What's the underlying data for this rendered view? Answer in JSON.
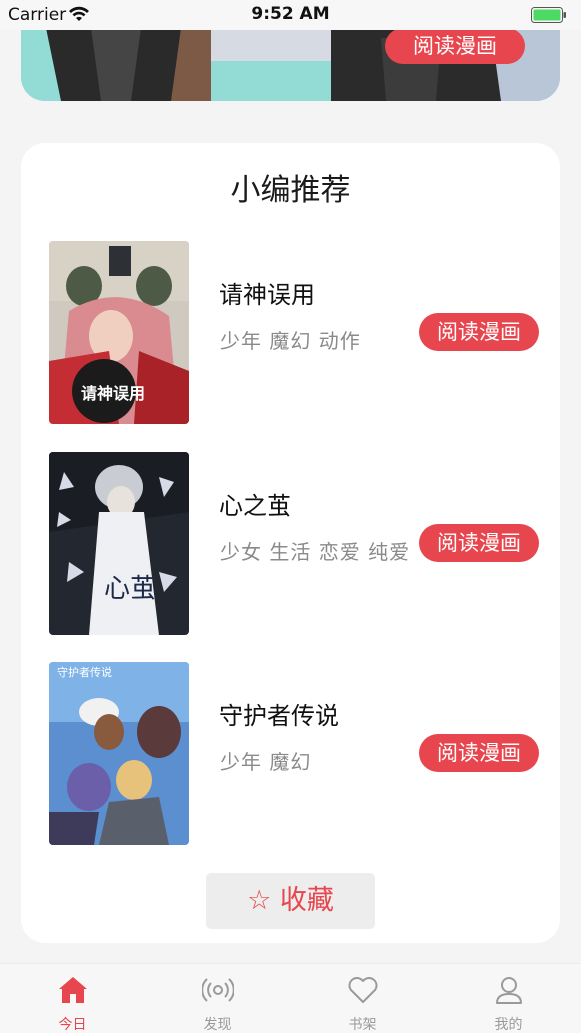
{
  "status_bar": {
    "carrier": "Carrier",
    "time": "9:52 AM"
  },
  "banner": {
    "read_button": "阅读漫画"
  },
  "recommend": {
    "title": "小编推荐",
    "comics": [
      {
        "name": "请神误用",
        "tags": "少年 魔幻 动作",
        "read_button": "阅读漫画",
        "cover_text": "请神误用"
      },
      {
        "name": "心之茧",
        "tags": "少女 生活 恋爱 纯爱",
        "read_button": "阅读漫画",
        "cover_text": "心茧"
      },
      {
        "name": "守护者传说",
        "tags": "少年 魔幻",
        "read_button": "阅读漫画",
        "cover_text": "守护者传说"
      }
    ],
    "collect_icon": "☆",
    "collect_label": "收藏"
  },
  "tab_bar": {
    "tabs": [
      {
        "label": "今日",
        "icon": "home-icon",
        "active": true
      },
      {
        "label": "发现",
        "icon": "broadcast-icon",
        "active": false
      },
      {
        "label": "书架",
        "icon": "heart-icon",
        "active": false
      },
      {
        "label": "我的",
        "icon": "user-icon",
        "active": false
      }
    ]
  },
  "colors": {
    "accent": "#e8464e",
    "background": "#f4f4f4",
    "card": "#ffffff"
  }
}
